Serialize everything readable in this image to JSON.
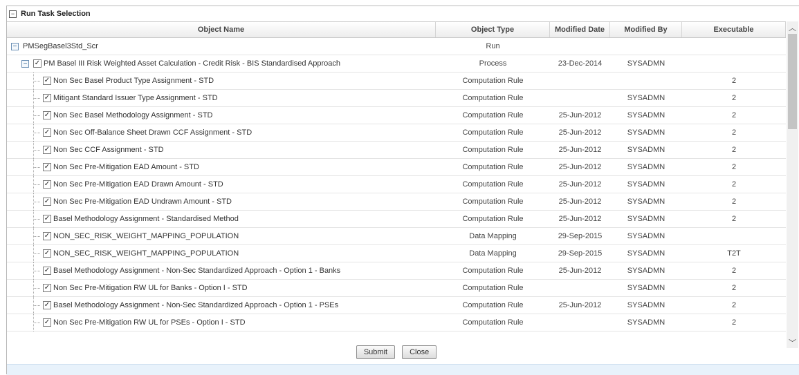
{
  "panel": {
    "title": "Run Task Selection",
    "toggle_symbol": "⊟"
  },
  "columns": {
    "name": "Object Name",
    "type": "Object Type",
    "date": "Modified Date",
    "by": "Modified By",
    "exec": "Executable"
  },
  "run_row": {
    "name": "PMSegBasel3Std_Scr",
    "type": "Run",
    "date": "",
    "by": "",
    "exec": ""
  },
  "process_row": {
    "name": "PM Basel III Risk Weighted Asset Calculation - Credit Risk - BIS Standardised Approach",
    "type": "Process",
    "date": "23-Dec-2014",
    "by": "SYSADMN",
    "exec": ""
  },
  "tasks": [
    {
      "name": "Non Sec Basel Product Type Assignment - STD",
      "type": "Computation Rule",
      "date": "",
      "by": "",
      "exec": "2"
    },
    {
      "name": "Mitigant Standard Issuer Type Assignment - STD",
      "type": "Computation Rule",
      "date": "",
      "by": "SYSADMN",
      "exec": "2"
    },
    {
      "name": "Non Sec Basel Methodology Assignment - STD",
      "type": "Computation Rule",
      "date": "25-Jun-2012",
      "by": "SYSADMN",
      "exec": "2"
    },
    {
      "name": "Non Sec Off-Balance Sheet Drawn CCF Assignment - STD",
      "type": "Computation Rule",
      "date": "25-Jun-2012",
      "by": "SYSADMN",
      "exec": "2"
    },
    {
      "name": "Non Sec CCF Assignment - STD",
      "type": "Computation Rule",
      "date": "25-Jun-2012",
      "by": "SYSADMN",
      "exec": "2"
    },
    {
      "name": "Non Sec Pre-Mitigation EAD Amount - STD",
      "type": "Computation Rule",
      "date": "25-Jun-2012",
      "by": "SYSADMN",
      "exec": "2"
    },
    {
      "name": "Non Sec Pre-Mitigation EAD Drawn Amount - STD",
      "type": "Computation Rule",
      "date": "25-Jun-2012",
      "by": "SYSADMN",
      "exec": "2"
    },
    {
      "name": "Non Sec Pre-Mitigation EAD Undrawn Amount - STD",
      "type": "Computation Rule",
      "date": "25-Jun-2012",
      "by": "SYSADMN",
      "exec": "2"
    },
    {
      "name": "Basel Methodology Assignment - Standardised Method",
      "type": "Computation Rule",
      "date": "25-Jun-2012",
      "by": "SYSADMN",
      "exec": "2"
    },
    {
      "name": "NON_SEC_RISK_WEIGHT_MAPPING_POPULATION",
      "type": "Data Mapping",
      "date": "29-Sep-2015",
      "by": "SYSADMN",
      "exec": ""
    },
    {
      "name": "NON_SEC_RISK_WEIGHT_MAPPING_POPULATION",
      "type": "Data Mapping",
      "date": "29-Sep-2015",
      "by": "SYSADMN",
      "exec": "T2T"
    },
    {
      "name": "Basel Methodology Assignment - Non-Sec Standardized Approach - Option 1 - Banks",
      "type": "Computation Rule",
      "date": "25-Jun-2012",
      "by": "SYSADMN",
      "exec": "2"
    },
    {
      "name": "Non Sec Pre-Mitigation RW UL for Banks - Option I - STD",
      "type": "Computation Rule",
      "date": "",
      "by": "SYSADMN",
      "exec": "2"
    },
    {
      "name": "Basel Methodology Assignment - Non-Sec Standardized Approach - Option 1 - PSEs",
      "type": "Computation Rule",
      "date": "25-Jun-2012",
      "by": "SYSADMN",
      "exec": "2"
    },
    {
      "name": "Non Sec Pre-Mitigation RW UL for PSEs - Option I - STD",
      "type": "Computation Rule",
      "date": "",
      "by": "SYSADMN",
      "exec": "2"
    }
  ],
  "buttons": {
    "submit": "Submit",
    "close": "Close"
  },
  "icons": {
    "check": "✓",
    "collapse": "−",
    "scroll_up": "⌃",
    "scroll_down": "⌄"
  },
  "colors": {
    "footer_band": "#e8f2fb",
    "tree_button_border": "#6a8fb5"
  }
}
